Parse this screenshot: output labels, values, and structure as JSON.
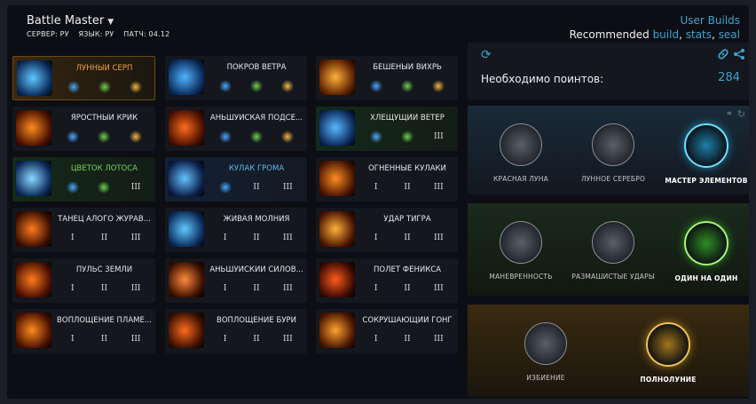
{
  "header": {
    "title": "Battle Master",
    "server_label": "СЕРВЕР: РУ",
    "lang_label": "ЯЗЫК: РУ",
    "patch_label": "ПАТЧ: 04.12",
    "user_builds": "User Builds",
    "recommended_prefix": "Recommended",
    "rec_build": "build",
    "rec_sep1": ",",
    "rec_stats": "stats",
    "rec_sep2": ",",
    "rec_seal": "seal"
  },
  "skills": [
    {
      "name": "ЛУННЫЙ СЕРП",
      "tone": "or",
      "bg": "o",
      "opts": [
        "icon",
        "icon",
        "icon"
      ],
      "palette": [
        "#0b2a5a",
        "#5fc8ff"
      ]
    },
    {
      "name": "ПОКРОВ ВЕТРА",
      "tone": "w",
      "bg": "",
      "opts": [
        "icon",
        "icon",
        "icon"
      ],
      "palette": [
        "#0b2a5a",
        "#4fb4ff"
      ]
    },
    {
      "name": "БЕШЕНЫЙ ВИХРЬ",
      "tone": "w",
      "bg": "",
      "opts": [
        "icon",
        "icon",
        "icon"
      ],
      "palette": [
        "#5a2000",
        "#ffb13a"
      ]
    },
    {
      "name": "ЯРОСТНЫЙ КРИК",
      "tone": "w",
      "bg": "",
      "opts": [
        "icon",
        "icon",
        "icon"
      ],
      "palette": [
        "#4a1200",
        "#ff8a1e"
      ]
    },
    {
      "name": "АНЬШУЙСКАЯ ПОДСЕ...",
      "tone": "w",
      "bg": "",
      "opts": [
        "icon",
        "icon",
        "icon"
      ],
      "palette": [
        "#4a1000",
        "#ff6a1e"
      ]
    },
    {
      "name": "ХЛЕЩУЩИЙ ВЕТЕР",
      "tone": "w",
      "bg": "g",
      "opts": [
        "icon",
        "icon",
        "III"
      ],
      "palette": [
        "#0b2a5a",
        "#58b7ff"
      ]
    },
    {
      "name": "ЦВЕТОК ЛОТОСА",
      "tone": "gr",
      "bg": "g",
      "opts": [
        "icon",
        "icon",
        "III"
      ],
      "palette": [
        "#0b2a5a",
        "#8ad8ff"
      ]
    },
    {
      "name": "КУЛАК ГРОМА",
      "tone": "bl",
      "bg": "b",
      "opts": [
        "icon",
        "II",
        "III"
      ],
      "palette": [
        "#0b1f4a",
        "#64c2ff"
      ]
    },
    {
      "name": "ОГНЕННЫЕ КУЛАКИ",
      "tone": "w",
      "bg": "",
      "opts": [
        "I",
        "II",
        "III"
      ],
      "palette": [
        "#4a1500",
        "#ff8d24"
      ]
    },
    {
      "name": "ТАНЕЦ АЛОГО ЖУРАВ...",
      "tone": "w",
      "bg": "",
      "opts": [
        "I",
        "II",
        "III"
      ],
      "palette": [
        "#3a0f00",
        "#ff7a1e"
      ]
    },
    {
      "name": "ЖИВАЯ МОЛНИЯ",
      "tone": "w",
      "bg": "",
      "opts": [
        "I",
        "II",
        "III"
      ],
      "palette": [
        "#0b2a5a",
        "#5fc8ff"
      ]
    },
    {
      "name": "УДАР ТИГРА",
      "tone": "w",
      "bg": "",
      "opts": [
        "I",
        "II",
        "III"
      ],
      "palette": [
        "#4a1500",
        "#ffb13a"
      ]
    },
    {
      "name": "ПУЛЬС ЗЕМЛИ",
      "tone": "w",
      "bg": "",
      "opts": [
        "I",
        "II",
        "III"
      ],
      "palette": [
        "#4a1000",
        "#ff7a1e"
      ]
    },
    {
      "name": "АНЬШУЙСКИЙ СИЛОВ...",
      "tone": "w",
      "bg": "",
      "opts": [
        "I",
        "II",
        "III"
      ],
      "palette": [
        "#3a0f00",
        "#ff8a3a"
      ]
    },
    {
      "name": "ПОЛЕТ ФЕНИКСА",
      "tone": "w",
      "bg": "",
      "opts": [
        "I",
        "II",
        "III"
      ],
      "palette": [
        "#3a0a00",
        "#ff5a1e"
      ]
    },
    {
      "name": "ВОПЛОЩЕНИЕ ПЛАМЕ...",
      "tone": "w",
      "bg": "",
      "opts": [
        "I",
        "II",
        "III"
      ],
      "palette": [
        "#4a1000",
        "#ff8a1e"
      ]
    },
    {
      "name": "ВОПЛОЩЕНИЕ БУРИ",
      "tone": "w",
      "bg": "",
      "opts": [
        "I",
        "II",
        "III"
      ],
      "palette": [
        "#3a0f00",
        "#ff6a1e"
      ]
    },
    {
      "name": "СОКРУШАЮЩИЙ ГОНГ",
      "tone": "w",
      "bg": "",
      "opts": [
        "I",
        "II",
        "III"
      ],
      "palette": [
        "#4a1500",
        "#ffa12e"
      ]
    }
  ],
  "points": {
    "label": "Необходимо поинтов:",
    "value": "284"
  },
  "talent_rows": [
    {
      "theme": "blue",
      "items": [
        {
          "label": "КРАСНАЯ ЛУНА",
          "active": false,
          "icon": "flame-icon"
        },
        {
          "label": "ЛУННОЕ СЕРЕБРО",
          "active": false,
          "icon": "lightning-icon"
        },
        {
          "label": "МАСТЕР ЭЛЕМЕНТОВ",
          "active": true,
          "icon": "potion-icon"
        }
      ]
    },
    {
      "theme": "green",
      "items": [
        {
          "label": "МАНЕВРЕННОСТЬ",
          "active": false,
          "icon": "runner-icon"
        },
        {
          "label": "РАЗМАШИСТЫЕ УДАРЫ",
          "active": false,
          "icon": "arrows-icon"
        },
        {
          "label": "ОДИН НА ОДИН",
          "active": true,
          "icon": "person-icon"
        }
      ]
    },
    {
      "theme": "gold",
      "items": [
        {
          "label": "ИЗБИЕНИЕ",
          "active": false,
          "icon": "slash-icon"
        },
        {
          "label": "ПОЛНОЛУНИЕ",
          "active": true,
          "icon": "sword-moon-icon"
        }
      ]
    }
  ]
}
